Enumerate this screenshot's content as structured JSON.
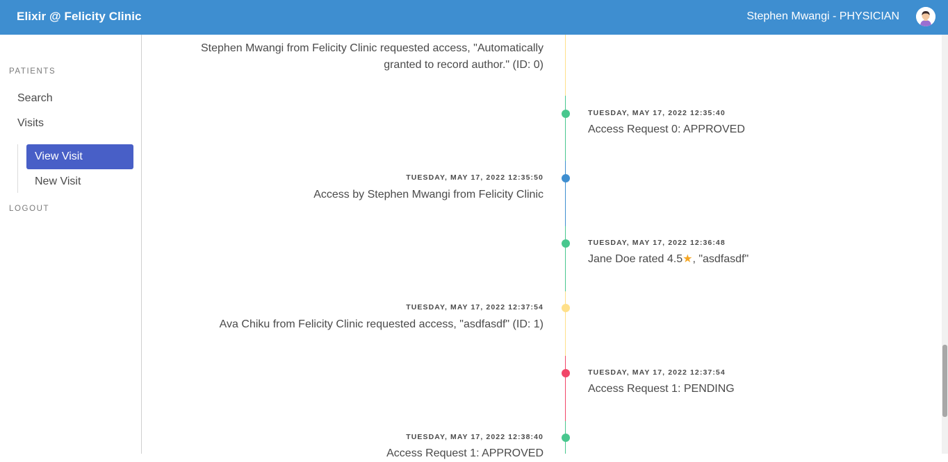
{
  "navbar": {
    "brand": "Elixir @ Felicity Clinic",
    "user": "Stephen Mwangi - PHYSICIAN"
  },
  "sidebar": {
    "patients_label": "PATIENTS",
    "search": "Search",
    "visits": "Visits",
    "view_visit": "View Visit",
    "new_visit": "New Visit",
    "logout": "LOGOUT"
  },
  "timeline": {
    "items": [
      {
        "side": "left",
        "time": "",
        "text": "Stephen Mwangi from Felicity Clinic requested access, \"Automatically granted to record author.\" (ID: 0)",
        "color": "#ffe08a"
      },
      {
        "side": "right",
        "time": "TUESDAY, MAY 17, 2022 12:35:40",
        "text": "Access Request 0: APPROVED",
        "color": "#48c78e"
      },
      {
        "side": "left",
        "time": "TUESDAY, MAY 17, 2022 12:35:50",
        "text": "Access by Stephen Mwangi from Felicity Clinic",
        "color": "#3e8ed0"
      },
      {
        "side": "right",
        "time": "TUESDAY, MAY 17, 2022 12:36:48",
        "text_before": "Jane Doe rated 4.5",
        "star": "★",
        "text_after": ", \"asdfasdf\"",
        "color": "#48c78e"
      },
      {
        "side": "left",
        "time": "TUESDAY, MAY 17, 2022 12:37:54",
        "text": "Ava Chiku from Felicity Clinic requested access, \"asdfasdf\" (ID: 1)",
        "color": "#ffe08a"
      },
      {
        "side": "right",
        "time": "TUESDAY, MAY 17, 2022 12:37:54",
        "text": "Access Request 1: PENDING",
        "color": "#f14668"
      },
      {
        "side": "left",
        "time": "TUESDAY, MAY 17, 2022 12:38:40",
        "text": "Access Request 1: APPROVED",
        "color": "#48c78e"
      }
    ]
  },
  "colors": {
    "navbar": "#3e8ed0",
    "active": "#485fc7",
    "success": "#48c78e",
    "info": "#3e8ed0",
    "warning": "#ffe08a",
    "danger": "#f14668",
    "star": "#f5a623"
  },
  "icons": {
    "avatar": "user-avatar-icon"
  }
}
